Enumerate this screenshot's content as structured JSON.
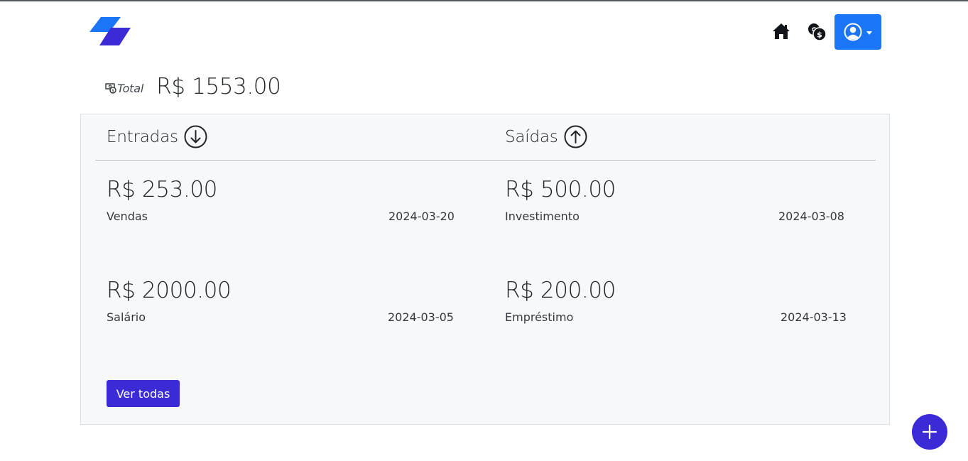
{
  "app": {
    "logo": "app-logo"
  },
  "nav": {
    "home_icon": "house-icon",
    "finance_icon": "coins-icon",
    "user_icon": "person-circle-icon"
  },
  "summary": {
    "total_label": "Total",
    "total_value": "R$ 1553.00"
  },
  "entradas": {
    "title": "Entradas",
    "icon": "arrow-down-circle-icon",
    "items": [
      {
        "amount": "R$ 253.00",
        "category": "Vendas",
        "date": "2024-03-20"
      },
      {
        "amount": "R$ 2000.00",
        "category": "Salário",
        "date": "2024-03-05"
      }
    ]
  },
  "saidas": {
    "title": "Saídas",
    "icon": "arrow-up-circle-icon",
    "items": [
      {
        "amount": "R$ 500.00",
        "category": "Investimento",
        "date": "2024-03-08"
      },
      {
        "amount": "R$ 200.00",
        "category": "Empréstimo",
        "date": "2024-03-13"
      }
    ]
  },
  "actions": {
    "view_all": "Ver todas",
    "add_icon": "plus-icon"
  },
  "colors": {
    "primary": "#3a2bd6",
    "user_button": "#1a75f7",
    "card_bg": "#f7f8fa"
  }
}
